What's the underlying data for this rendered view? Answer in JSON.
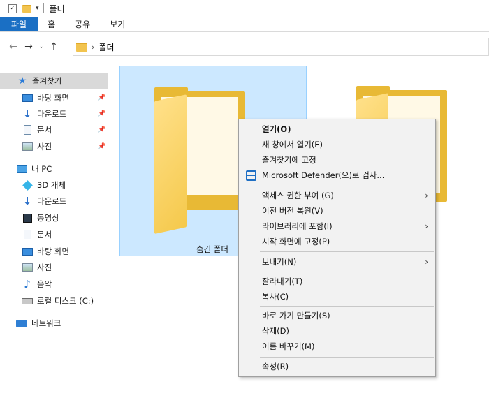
{
  "title": "폴더",
  "ribbon": {
    "tabs": [
      "파일",
      "홈",
      "공유",
      "보기"
    ]
  },
  "address": {
    "path": "폴더"
  },
  "nav": {
    "favorites": "즐겨찾기",
    "fav_items": [
      "바탕 화면",
      "다운로드",
      "문서",
      "사진"
    ],
    "pc": "내 PC",
    "pc_items": [
      "3D 개체",
      "다운로드",
      "동영상",
      "문서",
      "바탕 화면",
      "사진",
      "음악",
      "로컬 디스크 (C:)"
    ],
    "network": "네트워크"
  },
  "content": {
    "folder1_label": "숨긴 폴더"
  },
  "menu": {
    "open": "열기(O)",
    "open_new": "새 창에서 열기(E)",
    "pin_fav": "즐겨찾기에 고정",
    "defender": "Microsoft Defender(으)로 검사...",
    "access": "액세스 권한 부여 (G)",
    "restore": "이전 버전 복원(V)",
    "library": "라이브러리에 포함(I)",
    "pin_start": "시작 화면에 고정(P)",
    "send": "보내기(N)",
    "cut": "잘라내기(T)",
    "copy": "복사(C)",
    "shortcut": "바로 가기 만들기(S)",
    "delete": "삭제(D)",
    "rename": "이름 바꾸기(M)",
    "props": "속성(R)"
  }
}
